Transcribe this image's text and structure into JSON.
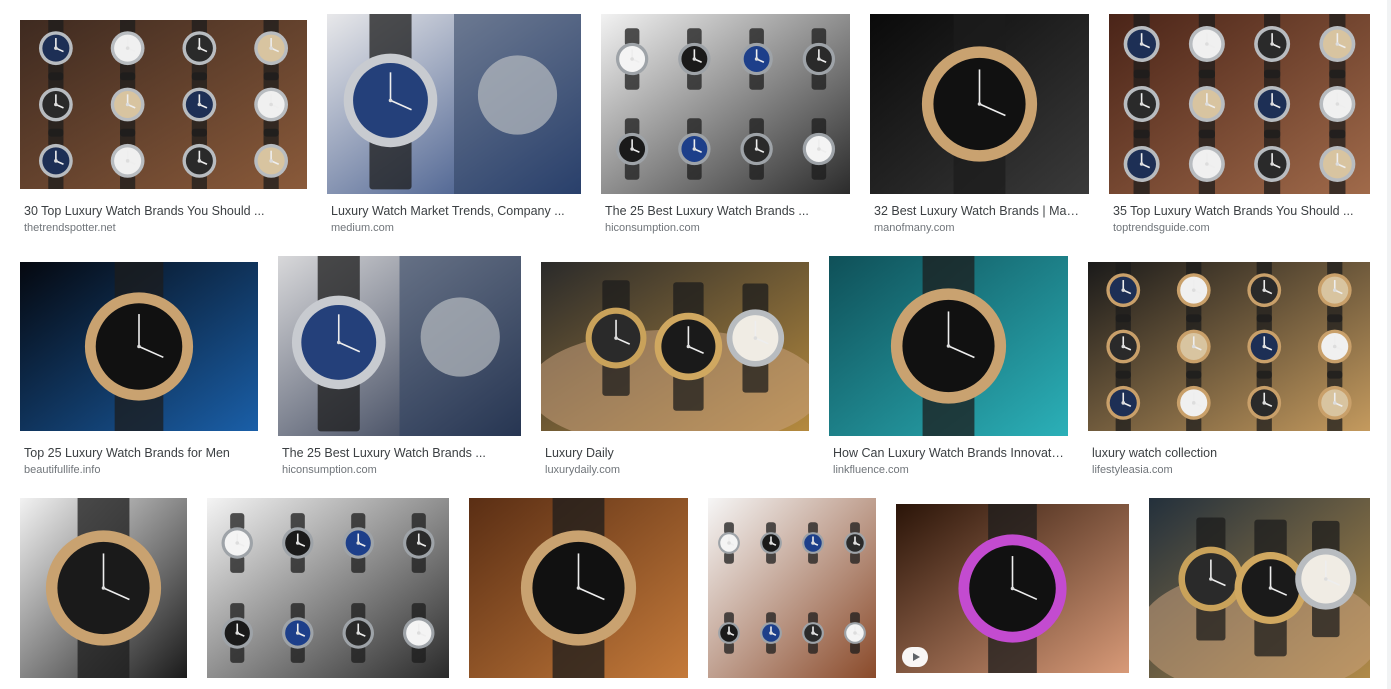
{
  "results": [
    {
      "caption": "30 Top Luxury Watch Brands You Should ...",
      "source": "thetrendspotter.net",
      "thumb_icon": "watch-box-icon",
      "colors": [
        "#3e2a20",
        "#8a5a3a"
      ]
    },
    {
      "caption": "Luxury Watch Market Trends, Company ...",
      "source": "medium.com",
      "thumb_icon": "royal-oak-watch-icon",
      "colors": [
        "#e8e8ea",
        "#24407a"
      ]
    },
    {
      "caption": "The 25 Best Luxury Watch Brands ...",
      "source": "hiconsumption.com",
      "thumb_icon": "watch-grid-icon",
      "colors": [
        "#f2f2f2",
        "#2b2b2b"
      ]
    },
    {
      "caption": "32 Best Luxury Watch Brands | Man ...",
      "source": "manofmany.com",
      "thumb_icon": "dark-dial-watch-icon",
      "colors": [
        "#0a0a0a",
        "#3a3a3a"
      ]
    },
    {
      "caption": "35 Top Luxury Watch Brands You Should ...",
      "source": "toptrendsguide.com",
      "thumb_icon": "watch-box-icon",
      "colors": [
        "#4a2418",
        "#a06a4a"
      ]
    },
    {
      "caption": "Top 25 Luxury Watch Brands for Men",
      "source": "beautifullife.info",
      "thumb_icon": "tourbillon-watch-icon",
      "colors": [
        "#05080f",
        "#1a5fa8"
      ]
    },
    {
      "caption": "The 25 Best Luxury Watch Brands ...",
      "source": "hiconsumption.com",
      "thumb_icon": "dress-watch-icon",
      "colors": [
        "#d8d8da",
        "#1f2a44"
      ]
    },
    {
      "caption": "Luxury Daily",
      "source": "luxurydaily.com",
      "thumb_icon": "wrist-watches-icon",
      "colors": [
        "#2a2a2a",
        "#b58a3e"
      ]
    },
    {
      "caption": "How Can Luxury Watch Brands Innovate ...",
      "source": "linkfluence.com",
      "thumb_icon": "rose-gold-watch-icon",
      "colors": [
        "#0f5058",
        "#2bb0b8"
      ]
    },
    {
      "caption": "luxury watch collection",
      "source": "lifestyleasia.com",
      "thumb_icon": "watch-display-icon",
      "colors": [
        "#1a1a1a",
        "#c49a5e"
      ]
    },
    {
      "caption": "",
      "source": "",
      "thumb_icon": "chronograph-watch-icon",
      "colors": [
        "#f2f2f2",
        "#1a1a1a"
      ]
    },
    {
      "caption": "",
      "source": "",
      "thumb_icon": "watch-grid-icon",
      "colors": [
        "#f4f4f4",
        "#2a2a2a"
      ]
    },
    {
      "caption": "",
      "source": "",
      "thumb_icon": "skeleton-watch-icon",
      "colors": [
        "#5a2e14",
        "#c47a3a"
      ]
    },
    {
      "caption": "",
      "source": "",
      "thumb_icon": "watch-pattern-icon",
      "colors": [
        "#f6f6f6",
        "#8a4a2a"
      ]
    },
    {
      "caption": "",
      "source": "",
      "thumb_icon": "rainbow-bezel-watch-icon",
      "colors": [
        "#2a1408",
        "#d89a78"
      ],
      "has_video": true
    },
    {
      "caption": "",
      "source": "",
      "thumb_icon": "wrist-watches-icon",
      "colors": [
        "#23303c",
        "#b08a48"
      ]
    }
  ]
}
